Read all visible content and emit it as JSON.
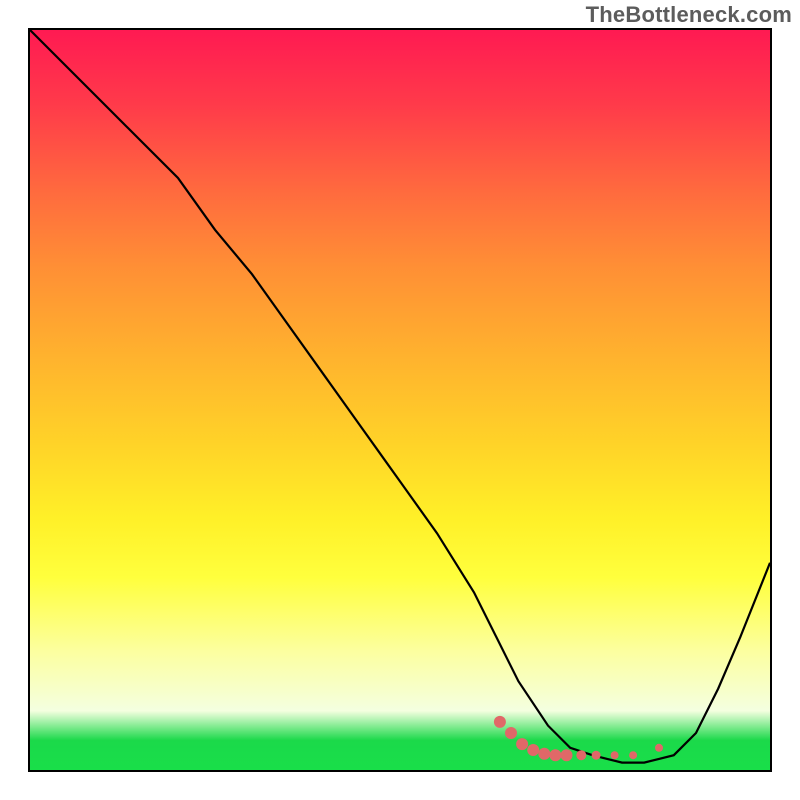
{
  "watermark": "TheBottleneck.com",
  "colors": {
    "curve": "#000000",
    "marker": "#e06868"
  },
  "chart_data": {
    "type": "line",
    "title": "",
    "xlabel": "",
    "ylabel": "",
    "xlim": [
      0,
      100
    ],
    "ylim": [
      0,
      100
    ],
    "x": [
      0,
      5,
      10,
      15,
      20,
      25,
      30,
      35,
      40,
      45,
      50,
      55,
      60,
      63,
      66,
      70,
      73,
      76,
      78,
      80,
      83,
      85,
      87,
      90,
      93,
      96,
      100
    ],
    "y": [
      100,
      95,
      90,
      85,
      80,
      73,
      67,
      60,
      53,
      46,
      39,
      32,
      24,
      18,
      12,
      6,
      3,
      2,
      1.5,
      1,
      1,
      1.5,
      2,
      5,
      11,
      18,
      28
    ],
    "markers": {
      "series": [
        {
          "x": 63.5,
          "y": 6.5,
          "r": 6
        },
        {
          "x": 65.0,
          "y": 5.0,
          "r": 6
        },
        {
          "x": 66.5,
          "y": 3.5,
          "r": 6
        },
        {
          "x": 68.0,
          "y": 2.7,
          "r": 6
        },
        {
          "x": 69.5,
          "y": 2.2,
          "r": 6
        },
        {
          "x": 71.0,
          "y": 2.0,
          "r": 6
        },
        {
          "x": 72.5,
          "y": 2.0,
          "r": 6
        },
        {
          "x": 74.5,
          "y": 2.0,
          "r": 5
        },
        {
          "x": 76.5,
          "y": 2.0,
          "r": 4.5
        },
        {
          "x": 79.0,
          "y": 2.0,
          "r": 4
        },
        {
          "x": 81.5,
          "y": 2.0,
          "r": 4
        },
        {
          "x": 85.0,
          "y": 3.0,
          "r": 4
        }
      ]
    }
  }
}
